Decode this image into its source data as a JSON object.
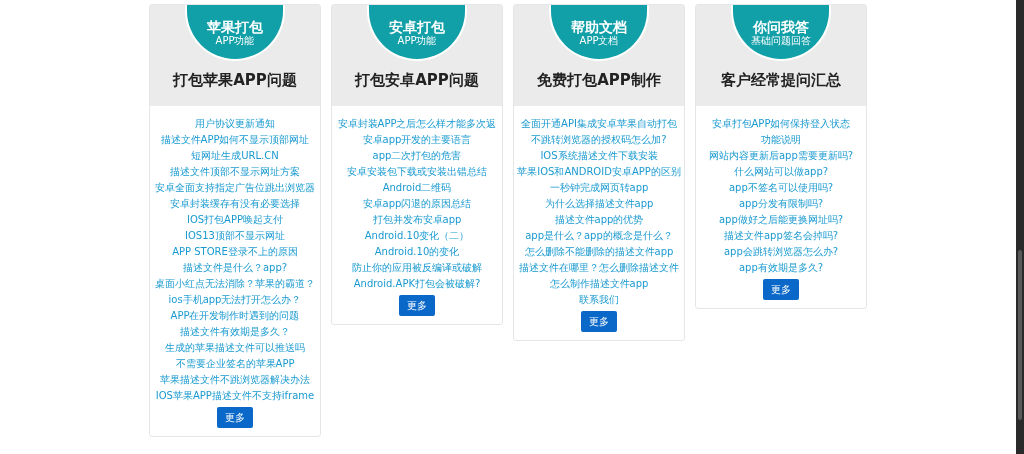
{
  "cards": [
    {
      "badge_title": "苹果打包",
      "badge_subtitle": "APP功能",
      "title": "打包苹果APP问题",
      "links": [
        "用户协议更新通知",
        "描述文件APP如何不显示顶部网址",
        "短网址生成URL.CN",
        "描述文件顶部不显示网址方案",
        "安卓全面支持指定广告位跳出浏览器",
        "安卓封装缓存有没有必要选择",
        "IOS打包APP唤起支付",
        "IOS13顶部不显示网址",
        "APP STORE登录不上的原因",
        "描述文件是什么？app?",
        "桌面小红点无法消除？苹果的霸道？",
        "ios手机app无法打开怎么办？",
        "APP在开发制作时遇到的问题",
        "描述文件有效期是多久？",
        "生成的苹果描述文件可以推送吗",
        "不需要企业签名的苹果APP",
        "苹果描述文件不跳浏览器解决办法",
        "IOS苹果APP描述文件不支持iframe"
      ],
      "more": "更多"
    },
    {
      "badge_title": "安卓打包",
      "badge_subtitle": "APP功能",
      "title": "打包安卓APP问题",
      "links": [
        "安卓封装APP之后怎么样才能多次返",
        "安卓app开发的主要语言",
        "app二次打包的危害",
        "安卓安装包下载或安装出错总结",
        "Android二维码",
        "安卓app闪退的原因总结",
        "打包并发布安卓app",
        "Android.10变化（二）",
        "Android.10的变化",
        "防止你的应用被反编译或破解",
        "Android.APK打包会被破解?"
      ],
      "more": "更多"
    },
    {
      "badge_title": "帮助文档",
      "badge_subtitle": "APP文档",
      "title": "免费打包APP制作",
      "links": [
        "全面开通API集成安卓苹果自动打包",
        "不跳转浏览器的授权码怎么加?",
        "IOS系统描述文件下载安装",
        "苹果IOS和ANDROID安卓APP的区别",
        "一秒钟完成网页转app",
        "为什么选择描述文件app",
        "描述文件app的优势",
        "app是什么？app的概念是什么？",
        "怎么删除不能删除的描述文件app",
        "描述文件在哪里？怎么删除描述文件",
        "怎么制作描述文件app",
        "联系我们"
      ],
      "more": "更多"
    },
    {
      "badge_title": "你问我答",
      "badge_subtitle": "基础问题回答",
      "title": "客户经常提问汇总",
      "links": [
        "安卓打包APP如何保持登入状态",
        "功能说明",
        "网站内容更新后app需要更新吗?",
        "什么网站可以做app?",
        "app不签名可以使用吗?",
        "app分发有限制吗?",
        "app做好之后能更换网址吗?",
        "描述文件app签名会掉吗?",
        "app会跳转浏览器怎么办?",
        "app有效期是多久?"
      ],
      "more": "更多"
    }
  ]
}
